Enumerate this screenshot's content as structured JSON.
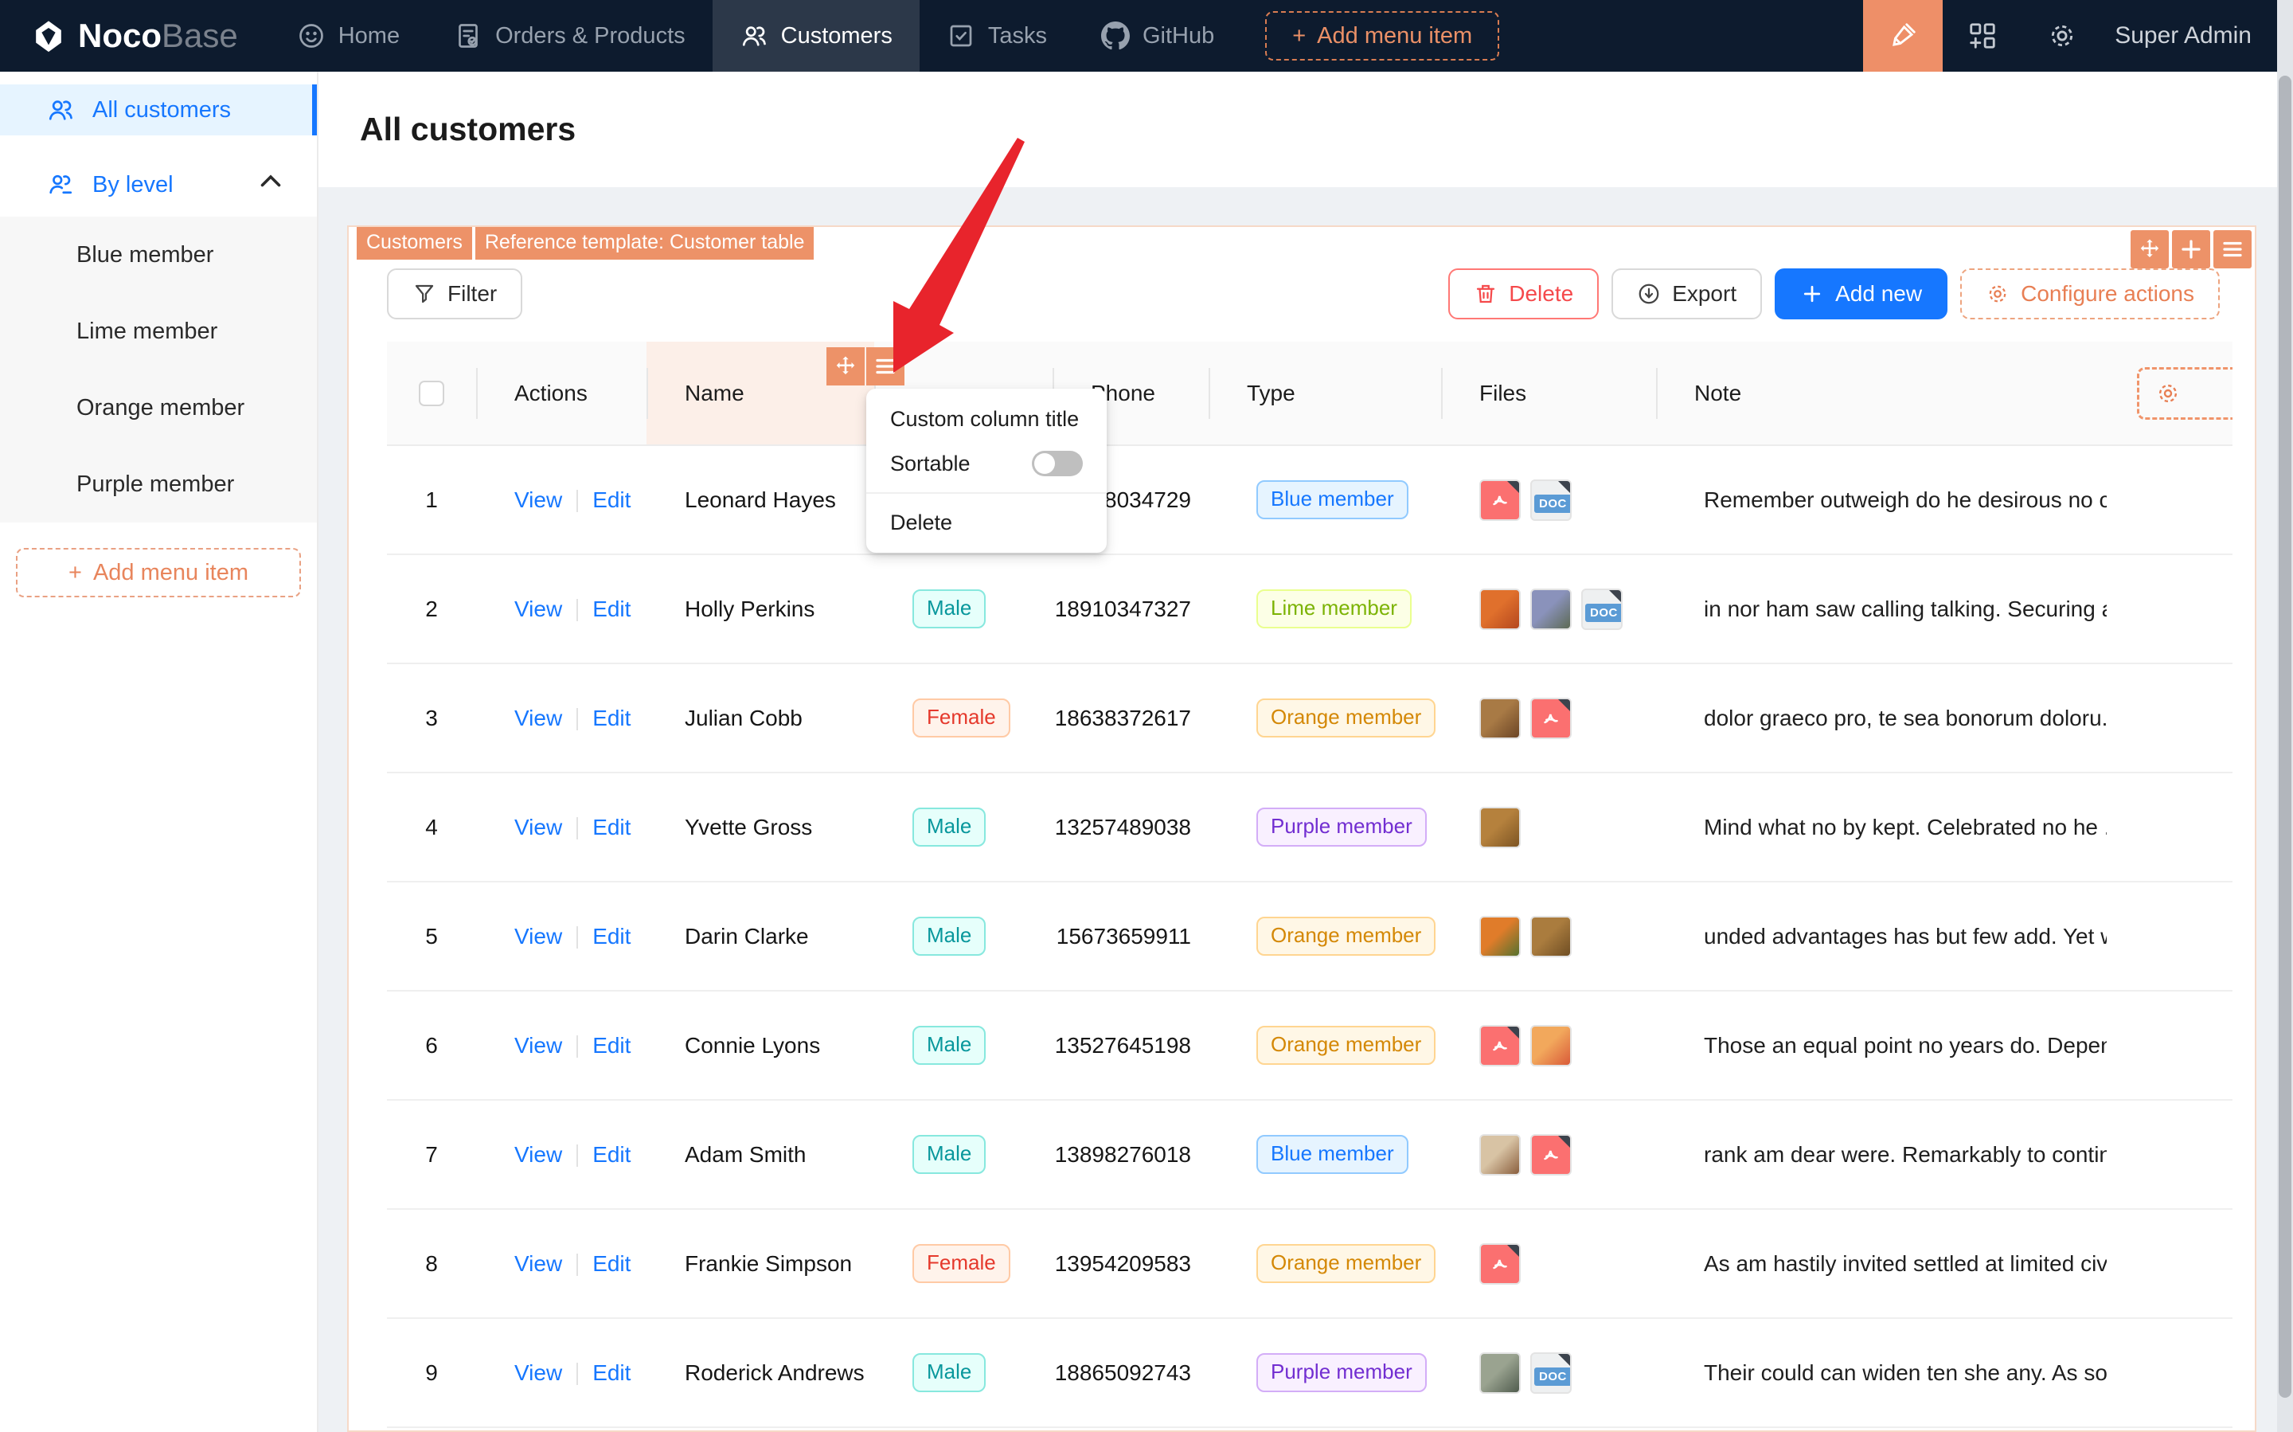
{
  "navbar": {
    "brand_bold": "Noco",
    "brand_light": "Base",
    "items": [
      {
        "label": "Home",
        "icon": "smiley-icon",
        "active": false
      },
      {
        "label": "Orders & Products",
        "icon": "orders-icon",
        "active": false
      },
      {
        "label": "Customers",
        "icon": "users-icon",
        "active": true
      },
      {
        "label": "Tasks",
        "icon": "tasks-icon",
        "active": false
      },
      {
        "label": "GitHub",
        "icon": "github-icon",
        "active": false
      }
    ],
    "add_menu_item": "Add menu item",
    "user_name": "Super Admin"
  },
  "sidebar": {
    "items": [
      {
        "label": "All customers",
        "icon": "users-icon",
        "active": true
      },
      {
        "label": "By level",
        "icon": "users-level-icon",
        "active": false,
        "expanded": true,
        "children": [
          "Blue member",
          "Lime member",
          "Orange member",
          "Purple member"
        ]
      }
    ],
    "add_menu_item": "Add menu item"
  },
  "page": {
    "title": "All customers"
  },
  "block": {
    "tags": [
      "Customers",
      "Reference template: Customer table"
    ],
    "toolbar": {
      "filter": "Filter",
      "delete": "Delete",
      "export": "Export",
      "add_new": "Add new",
      "configure_actions": "Configure actions"
    }
  },
  "column_menu": {
    "custom_title": "Custom column title",
    "sortable": "Sortable",
    "sortable_on": false,
    "delete": "Delete"
  },
  "table": {
    "columns": [
      {
        "key": "select",
        "label": ""
      },
      {
        "key": "actions",
        "label": "Actions"
      },
      {
        "key": "name",
        "label": "Name",
        "highlighted": true
      },
      {
        "key": "gender",
        "label": ""
      },
      {
        "key": "phone",
        "label": "Phone"
      },
      {
        "key": "type",
        "label": "Type"
      },
      {
        "key": "files",
        "label": "Files"
      },
      {
        "key": "note",
        "label": "Note"
      },
      {
        "key": "extra",
        "label": ""
      }
    ],
    "row_actions": [
      "View",
      "Edit"
    ],
    "rows": [
      {
        "index": 1,
        "name": "Leonard Hayes",
        "gender": "",
        "phone": "98034729",
        "type": "Blue member",
        "files": [
          {
            "kind": "pdf"
          },
          {
            "kind": "doc"
          }
        ],
        "note": "Remember outweigh do he desirous no c..."
      },
      {
        "index": 2,
        "name": "Holly Perkins",
        "gender": "Male",
        "phone": "18910347327",
        "type": "Lime member",
        "files": [
          {
            "kind": "image",
            "name": "fruit",
            "g": [
              "#e0702c",
              "#b4471e"
            ]
          },
          {
            "kind": "image",
            "name": "flowers",
            "g": [
              "#8a92bb",
              "#5d6a55"
            ]
          },
          {
            "kind": "doc"
          }
        ],
        "note": "in nor ham saw calling talking. Securing a..."
      },
      {
        "index": 3,
        "name": "Julian Cobb",
        "gender": "Female",
        "phone": "18638372617",
        "type": "Orange member",
        "files": [
          {
            "kind": "image",
            "name": "food",
            "g": [
              "#a87a45",
              "#6b4526"
            ]
          },
          {
            "kind": "pdf"
          }
        ],
        "note": "dolor graeco pro, te sea bonorum doloru..."
      },
      {
        "index": 4,
        "name": "Yvette Gross",
        "gender": "Male",
        "phone": "13257489038",
        "type": "Purple member",
        "files": [
          {
            "kind": "image",
            "name": "cookies",
            "g": [
              "#b5813d",
              "#7d5524"
            ]
          }
        ],
        "note": "Mind what no by kept. Celebrated no he ..."
      },
      {
        "index": 5,
        "name": "Darin Clarke",
        "gender": "Male",
        "phone": "15673659911",
        "type": "Orange member",
        "files": [
          {
            "kind": "image",
            "name": "oranges",
            "g": [
              "#e07c2a",
              "#55722f"
            ]
          },
          {
            "kind": "image",
            "name": "cookies",
            "g": [
              "#aa7c3e",
              "#6f4e24"
            ]
          }
        ],
        "note": "unded advantages has but few add. Yet w..."
      },
      {
        "index": 6,
        "name": "Connie Lyons",
        "gender": "Male",
        "phone": "13527645198",
        "type": "Orange member",
        "files": [
          {
            "kind": "pdf"
          },
          {
            "kind": "image",
            "name": "peaches",
            "g": [
              "#f2a85c",
              "#d95b39"
            ]
          }
        ],
        "note": "Those an equal point no years do. Depen..."
      },
      {
        "index": 7,
        "name": "Adam Smith",
        "gender": "Male",
        "phone": "13898276018",
        "type": "Blue member",
        "files": [
          {
            "kind": "image",
            "name": "coffee",
            "g": [
              "#d8c3a4",
              "#8a5f3e"
            ]
          },
          {
            "kind": "pdf"
          }
        ],
        "note": "rank am dear were. Remarkably to contin..."
      },
      {
        "index": 8,
        "name": "Frankie Simpson",
        "gender": "Female",
        "phone": "13954209583",
        "type": "Orange member",
        "files": [
          {
            "kind": "pdf"
          }
        ],
        "note": "As am hastily invited settled at limited civ..."
      },
      {
        "index": 9,
        "name": "Roderick Andrews",
        "gender": "Male",
        "phone": "18865092743",
        "type": "Purple member",
        "files": [
          {
            "kind": "image",
            "name": "plants",
            "g": [
              "#9aa390",
              "#505c4e"
            ]
          },
          {
            "kind": "doc"
          }
        ],
        "note": "Their could can widen ten she any. As so ..."
      }
    ]
  },
  "doc_label": "DOC",
  "colors": {
    "accent_orange": "#ed9268",
    "primary_blue": "#1677ff",
    "arrow_red": "#e8242c",
    "navbar_bg": "#0d1b2e",
    "tag_styles": {
      "Male": {
        "bg": "#e6fffb",
        "border": "#87e8de",
        "text": "#08979c"
      },
      "Female": {
        "bg": "#fff3eb",
        "border": "#ffcaa5",
        "text": "#e5392c"
      },
      "Blue member": {
        "bg": "#e6f4ff",
        "border": "#91caff",
        "text": "#1677ff"
      },
      "Lime member": {
        "bg": "#fcffe6",
        "border": "#eaff8f",
        "text": "#7cb305"
      },
      "Orange member": {
        "bg": "#fff7e6",
        "border": "#ffd591",
        "text": "#d48806"
      },
      "Purple member": {
        "bg": "#f9f0ff",
        "border": "#d3adf7",
        "text": "#722ed1"
      }
    }
  }
}
